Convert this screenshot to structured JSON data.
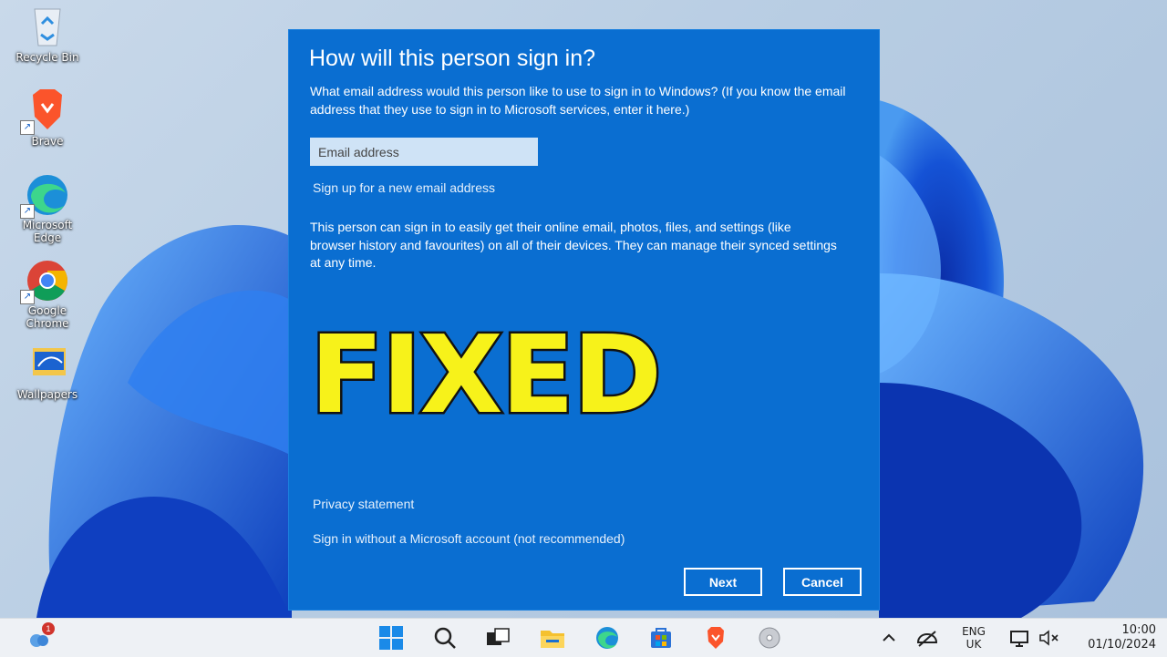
{
  "desktop": {
    "icons": [
      {
        "label": "Recycle Bin",
        "icon": "recycle-bin-icon"
      },
      {
        "label": "Brave",
        "icon": "brave-icon"
      },
      {
        "label": "Microsoft Edge",
        "icon": "edge-icon"
      },
      {
        "label": "Google Chrome",
        "icon": "chrome-icon"
      },
      {
        "label": "Wallpapers",
        "icon": "folder-icon"
      }
    ]
  },
  "dialog": {
    "title": "How will this person sign in?",
    "description": "What email address would this person like to use to sign in to Windows? (If you know the email address that they use to sign in to Microsoft services, enter it here.)",
    "email_placeholder": "Email address",
    "email_value": "",
    "signup_link": "Sign up for a new email address",
    "info": "This person can sign in to easily get their online email, photos, files, and settings (like browser history and favourites) on all of their devices. They can manage their synced settings at any time.",
    "privacy_link": "Privacy statement",
    "no_ms_account_link": "Sign in without a Microsoft account (not recommended)",
    "next_label": "Next",
    "cancel_label": "Cancel"
  },
  "overlay": {
    "text": "FIXED"
  },
  "taskbar": {
    "weather_badge": "1",
    "pinned": [
      "start-icon",
      "search-icon",
      "task-view-icon",
      "file-explorer-icon",
      "edge-icon",
      "store-icon",
      "brave-icon",
      "disc-icon"
    ],
    "language_top": "ENG",
    "language_bottom": "UK",
    "time": "10:00",
    "date": "01/10/2024"
  },
  "colors": {
    "dialog_bg": "#0a6ed1",
    "overlay_text": "#f7f21a",
    "input_bg": "#cfe3f6"
  }
}
